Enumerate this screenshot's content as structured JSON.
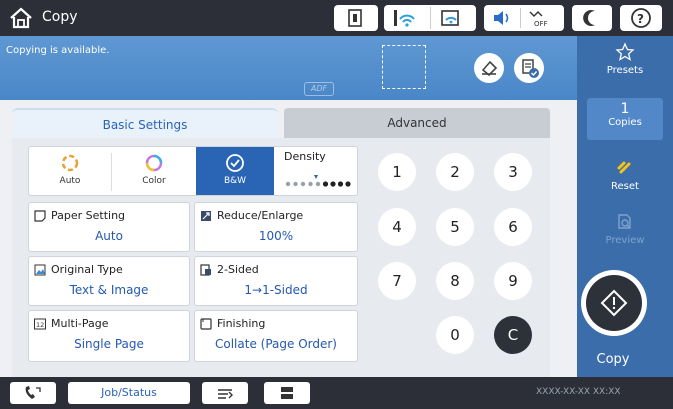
{
  "header": {
    "title": "Copy"
  },
  "banner": {
    "message": "Copying is available.",
    "adf_label": "ADF"
  },
  "tabs": [
    {
      "label": "Basic Settings"
    },
    {
      "label": "Advanced"
    }
  ],
  "color_mode": {
    "auto": "Auto",
    "color": "Color",
    "bw": "B&W",
    "selected": "B&W"
  },
  "density": {
    "label": "Density",
    "level": 5,
    "max": 9
  },
  "settings": {
    "paper_setting": {
      "label": "Paper Setting",
      "value": "Auto"
    },
    "reduce_enlarge": {
      "label": "Reduce/Enlarge",
      "value": "100%"
    },
    "original_type": {
      "label": "Original Type",
      "value": "Text & Image"
    },
    "two_sided": {
      "label": "2-Sided",
      "value": "1→1-Sided"
    },
    "multi_page": {
      "label": "Multi-Page",
      "value": "Single Page"
    },
    "finishing": {
      "label": "Finishing",
      "value": "Collate (Page Order)"
    }
  },
  "keypad": {
    "k1": "1",
    "k2": "2",
    "k3": "3",
    "k4": "4",
    "k5": "5",
    "k6": "6",
    "k7": "7",
    "k8": "8",
    "k9": "9",
    "k0": "0",
    "clear": "C"
  },
  "sidebar": {
    "presets": "Presets",
    "copies_value": "1",
    "copies_label": "Copies",
    "reset": "Reset",
    "preview": "Preview",
    "copy": "Copy"
  },
  "footer": {
    "job_status": "Job/Status",
    "datetime": "XXXX-XX-XX XX:XX"
  },
  "colors": {
    "accent": "#3b6dab",
    "banner": "#5a95d1",
    "selected": "#2a64b5",
    "topbar": "#2c2f37"
  }
}
